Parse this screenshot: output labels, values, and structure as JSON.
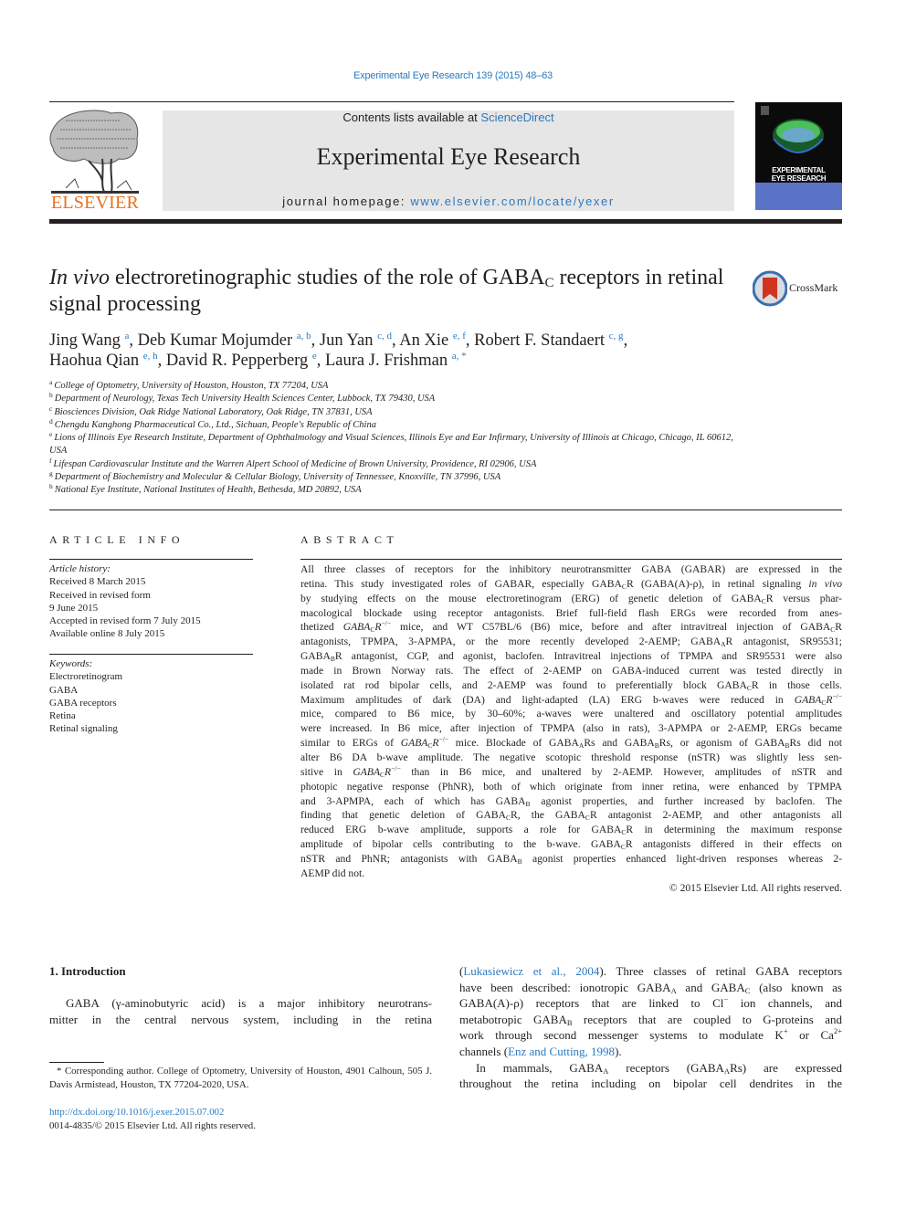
{
  "running_head": "Experimental Eye Research 139 (2015) 48–63",
  "masthead": {
    "contents_prefix": "Contents lists available at ",
    "contents_link": "ScienceDirect",
    "journal_title": "Experimental Eye Research",
    "homepage_prefix": "journal homepage: ",
    "homepage_link": "www.elsevier.com/locate/yexer",
    "publisher_logo_text": "ELSEVIER",
    "cover_title_line1": "EXPERIMENTAL",
    "cover_title_line2": "EYE RESEARCH",
    "colors": {
      "publisher_orange": "#e9711c",
      "link_blue": "#2a79c0",
      "masthead_gray": "#e6e6e6"
    }
  },
  "article": {
    "title_italic": "In vivo",
    "title_part1": " electroretinographic studies of the role of GABA",
    "title_sub": "C",
    "title_part2": " receptors in retinal signal processing",
    "crossmark_label": "CrossMark",
    "authors": [
      {
        "name": "Jing Wang",
        "affil": "a"
      },
      {
        "name": "Deb Kumar Mojumder",
        "affil": "a, b"
      },
      {
        "name": "Jun Yan",
        "affil": "c, d"
      },
      {
        "name": "An Xie",
        "affil": "e, f"
      },
      {
        "name": "Robert F. Standaert",
        "affil": "c, g"
      },
      {
        "name": "Haohua Qian",
        "affil": "e, h"
      },
      {
        "name": "David R. Pepperberg",
        "affil": "e"
      },
      {
        "name": "Laura J. Frishman",
        "affil": "a, *"
      }
    ],
    "affiliations": [
      {
        "key": "a",
        "text": "College of Optometry, University of Houston, Houston, TX 77204, USA"
      },
      {
        "key": "b",
        "text": "Department of Neurology, Texas Tech University Health Sciences Center, Lubbock, TX 79430, USA"
      },
      {
        "key": "c",
        "text": "Biosciences Division, Oak Ridge National Laboratory, Oak Ridge, TN 37831, USA"
      },
      {
        "key": "d",
        "text": "Chengdu Kanghong Pharmaceutical Co., Ltd., Sichuan, People's Republic of China"
      },
      {
        "key": "e",
        "text": "Lions of Illinois Eye Research Institute, Department of Ophthalmology and Visual Sciences, Illinois Eye and Ear Infirmary, University of Illinois at Chicago, Chicago, IL 60612, USA"
      },
      {
        "key": "f",
        "text": "Lifespan Cardiovascular Institute and the Warren Alpert School of Medicine of Brown University, Providence, RI 02906, USA"
      },
      {
        "key": "g",
        "text": "Department of Biochemistry and Molecular & Cellular Biology, University of Tennessee, Knoxville, TN 37996, USA"
      },
      {
        "key": "h",
        "text": "National Eye Institute, National Institutes of Health, Bethesda, MD 20892, USA"
      }
    ]
  },
  "article_info": {
    "heading": "ARTICLE INFO",
    "history_label": "Article history:",
    "history": [
      "Received 8 March 2015",
      "Received in revised form",
      "9 June 2015",
      "Accepted in revised form 7 July 2015",
      "Available online 8 July 2015"
    ],
    "keywords_label": "Keywords:",
    "keywords": [
      "Electroretinogram",
      "GABA",
      "GABA receptors",
      "Retina",
      "Retinal signaling"
    ]
  },
  "abstract": {
    "heading": "ABSTRACT",
    "lines": [
      [
        {
          "t": "All three classes of receptors for the inhibitory neurotransmitter GABA (GABAR) are expressed in the"
        }
      ],
      [
        {
          "t": "retina. This study investigated roles of GABAR, especially GABA"
        },
        {
          "t": "C",
          "s": "sub"
        },
        {
          "t": "R (GABA(A)-ρ), in retinal signaling "
        },
        {
          "t": "in vivo",
          "s": "i"
        }
      ],
      [
        {
          "t": "by studying effects on the mouse electroretinogram (ERG) of genetic deletion of GABA"
        },
        {
          "t": "C",
          "s": "sub"
        },
        {
          "t": "R versus phar-"
        }
      ],
      [
        {
          "t": "macological blockade using receptor antagonists. Brief full-field flash ERGs were recorded from anes-"
        }
      ],
      [
        {
          "t": "thetized "
        },
        {
          "t": "GABA",
          "s": "i"
        },
        {
          "t": "C",
          "s": "sub"
        },
        {
          "t": "R",
          "s": "i"
        },
        {
          "t": "−/−",
          "s": "sup"
        },
        {
          "t": " mice, and WT C57BL/6 (B6) mice, before and after intravitreal injection of GABA"
        },
        {
          "t": "C",
          "s": "sub"
        },
        {
          "t": "R"
        }
      ],
      [
        {
          "t": "antagonists, TPMPA, 3-APMPA, or the more recently developed 2-AEMP; GABA"
        },
        {
          "t": "A",
          "s": "sub"
        },
        {
          "t": "R antagonist, SR95531;"
        }
      ],
      [
        {
          "t": "GABA"
        },
        {
          "t": "B",
          "s": "sub"
        },
        {
          "t": "R antagonist, CGP, and agonist, baclofen. Intravitreal injections of TPMPA and SR95531 were also"
        }
      ],
      [
        {
          "t": "made in Brown Norway rats. The effect of 2-AEMP on GABA-induced current was tested directly in"
        }
      ],
      [
        {
          "t": "isolated rat rod bipolar cells, and 2-AEMP was found to preferentially block GABA"
        },
        {
          "t": "C",
          "s": "sub"
        },
        {
          "t": "R in those cells."
        }
      ],
      [
        {
          "t": "Maximum amplitudes of dark (DA) and light-adapted (LA) ERG b-waves were reduced in "
        },
        {
          "t": "GABA",
          "s": "i"
        },
        {
          "t": "C",
          "s": "sub"
        },
        {
          "t": "R",
          "s": "i"
        },
        {
          "t": "−/−",
          "s": "sup"
        }
      ],
      [
        {
          "t": "mice, compared to B6 mice, by 30–60%; a-waves were unaltered and oscillatory potential amplitudes"
        }
      ],
      [
        {
          "t": "were increased. In B6 mice, after injection of TPMPA (also in rats), 3-APMPA or 2-AEMP, ERGs became"
        }
      ],
      [
        {
          "t": "similar to ERGs of "
        },
        {
          "t": "GABA",
          "s": "i"
        },
        {
          "t": "C",
          "s": "sub"
        },
        {
          "t": "R",
          "s": "i"
        },
        {
          "t": "−/−",
          "s": "sup"
        },
        {
          "t": " mice. Blockade of GABA"
        },
        {
          "t": "A",
          "s": "sub"
        },
        {
          "t": "Rs and GABA"
        },
        {
          "t": "B",
          "s": "sub"
        },
        {
          "t": "Rs, or agonism of GABA"
        },
        {
          "t": "B",
          "s": "sub"
        },
        {
          "t": "Rs did not"
        }
      ],
      [
        {
          "t": "alter B6 DA b-wave amplitude. The negative scotopic threshold response (nSTR) was slightly less sen-"
        }
      ],
      [
        {
          "t": "sitive in "
        },
        {
          "t": "GABA",
          "s": "i"
        },
        {
          "t": "C",
          "s": "sub"
        },
        {
          "t": "R",
          "s": "i"
        },
        {
          "t": "−/−",
          "s": "sup"
        },
        {
          "t": " than in B6 mice, and unaltered by 2-AEMP. However, amplitudes of nSTR and"
        }
      ],
      [
        {
          "t": "photopic negative response (PhNR), both of which originate from inner retina, were enhanced by TPMPA"
        }
      ],
      [
        {
          "t": "and 3-APMPA, each of which has GABA"
        },
        {
          "t": "B",
          "s": "sub"
        },
        {
          "t": " agonist properties, and further increased by baclofen. The"
        }
      ],
      [
        {
          "t": "finding that genetic deletion of GABA"
        },
        {
          "t": "C",
          "s": "sub"
        },
        {
          "t": "R, the GABA"
        },
        {
          "t": "C",
          "s": "sub"
        },
        {
          "t": "R antagonist 2-AEMP, and other antagonists all"
        }
      ],
      [
        {
          "t": "reduced ERG b-wave amplitude, supports a role for GABA"
        },
        {
          "t": "C",
          "s": "sub"
        },
        {
          "t": "R in determining the maximum response"
        }
      ],
      [
        {
          "t": "amplitude of bipolar cells contributing to the b-wave. GABA"
        },
        {
          "t": "C",
          "s": "sub"
        },
        {
          "t": "R antagonists differed in their effects on"
        }
      ],
      [
        {
          "t": "nSTR and PhNR; antagonists with GABA"
        },
        {
          "t": "B",
          "s": "sub"
        },
        {
          "t": " agonist properties enhanced light-driven responses whereas 2-"
        }
      ],
      [
        {
          "t": "AEMP did not."
        }
      ]
    ],
    "copyright": "© 2015 Elsevier Ltd. All rights reserved."
  },
  "introduction": {
    "heading": "1.  Introduction",
    "col1_lines": [
      [
        {
          "t": "GABA (γ-aminobutyric acid) is a major inhibitory neurotrans-"
        }
      ],
      [
        {
          "t": "mitter in the central nervous system, including in the retina"
        }
      ]
    ],
    "col2_lines": [
      [
        {
          "t": "(",
          "s": ""
        },
        {
          "t": "Lukasiewicz et al., 2004",
          "s": "link"
        },
        {
          "t": "). Three classes of retinal GABA receptors"
        }
      ],
      [
        {
          "t": "have been described: ionotropic GABA"
        },
        {
          "t": "A",
          "s": "sub"
        },
        {
          "t": " and GABA"
        },
        {
          "t": "C",
          "s": "sub"
        },
        {
          "t": " (also known as"
        }
      ],
      [
        {
          "t": "GABA(A)-ρ) receptors that are linked to Cl"
        },
        {
          "t": "−",
          "s": "sup"
        },
        {
          "t": " ion channels, and"
        }
      ],
      [
        {
          "t": "metabotropic GABA"
        },
        {
          "t": "B",
          "s": "sub"
        },
        {
          "t": " receptors that are coupled to G-proteins and"
        }
      ],
      [
        {
          "t": "work through second messenger systems to modulate K"
        },
        {
          "t": "+",
          "s": "sup"
        },
        {
          "t": " or Ca"
        },
        {
          "t": "2+",
          "s": "sup"
        }
      ],
      [
        {
          "t": "channels ("
        },
        {
          "t": "Enz and Cutting, 1998",
          "s": "link"
        },
        {
          "t": ")."
        }
      ],
      [
        {
          "t": "In mammals, GABA"
        },
        {
          "t": "A",
          "s": "sub"
        },
        {
          "t": " receptors (GABA"
        },
        {
          "t": "A",
          "s": "sub"
        },
        {
          "t": "Rs) are expressed"
        }
      ],
      [
        {
          "t": "throughout the retina including on bipolar cell dendrites in the"
        }
      ]
    ]
  },
  "footnote": {
    "text": "* Corresponding author. College of Optometry, University of Houston, 4901 Calhoun, 505 J. Davis Armistead, Houston, TX 77204-2020, USA.",
    "doi_link": "http://dx.doi.org/10.1016/j.exer.2015.07.002",
    "issn_line": "0014-4835/© 2015 Elsevier Ltd. All rights reserved."
  }
}
